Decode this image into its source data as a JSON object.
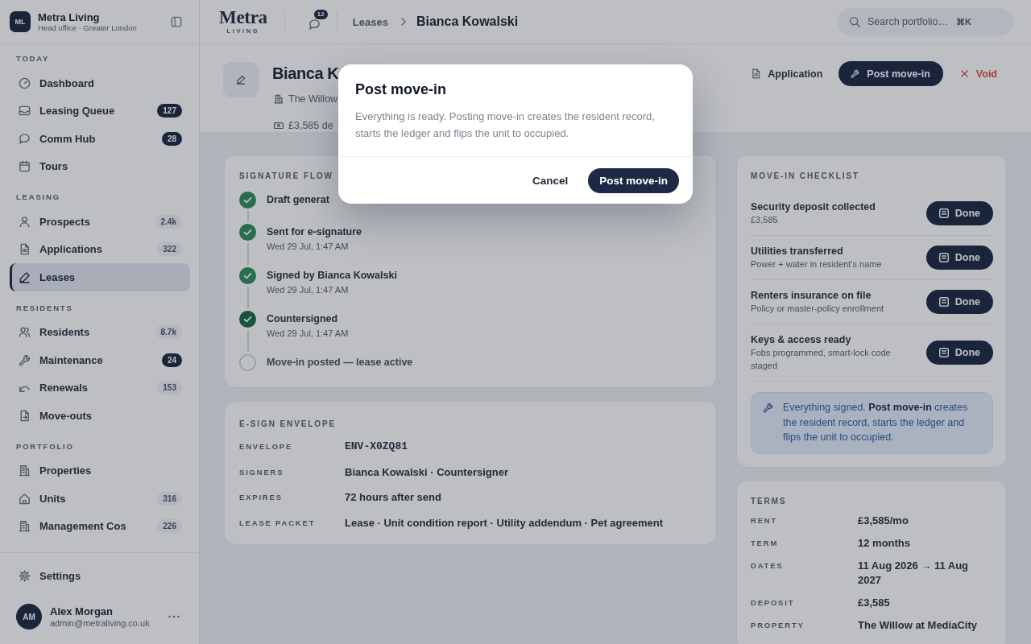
{
  "sidebar": {
    "brand": {
      "logo": "ML",
      "name": "Metra Living",
      "subtitle": "Head office · Greater London"
    },
    "sections": [
      {
        "label": "TODAY",
        "items": [
          {
            "label": "Dashboard",
            "selected": false
          },
          {
            "label": "Leasing Queue",
            "selected": false,
            "badge": {
              "text": "127",
              "urgent": true
            }
          },
          {
            "label": "Comm Hub",
            "selected": false,
            "badge": {
              "text": "28",
              "urgent": true
            }
          },
          {
            "label": "Tours",
            "selected": false
          }
        ]
      },
      {
        "label": "LEASING",
        "items": [
          {
            "label": "Prospects",
            "selected": false,
            "badge": {
              "text": "2.4k",
              "urgent": false
            }
          },
          {
            "label": "Applications",
            "selected": false,
            "badge": {
              "text": "322",
              "urgent": false
            }
          },
          {
            "label": "Leases",
            "selected": true
          }
        ]
      },
      {
        "label": "RESIDENTS",
        "items": [
          {
            "label": "Residents",
            "selected": false,
            "badge": {
              "text": "8.7k",
              "urgent": false
            }
          },
          {
            "label": "Maintenance",
            "selected": false,
            "badge": {
              "text": "24",
              "urgent": true
            }
          },
          {
            "label": "Renewals",
            "selected": false,
            "badge": {
              "text": "153",
              "urgent": false
            }
          },
          {
            "label": "Move-outs",
            "selected": false
          }
        ]
      },
      {
        "label": "PORTFOLIO",
        "items": [
          {
            "label": "Properties",
            "selected": false
          },
          {
            "label": "Units",
            "selected": false,
            "badge": {
              "text": "316",
              "urgent": false
            }
          },
          {
            "label": "Management Cos",
            "selected": false,
            "badge": {
              "text": "226",
              "urgent": false
            }
          }
        ]
      }
    ],
    "footer_items": [
      {
        "label": "Settings",
        "selected": false
      }
    ],
    "user": {
      "initials": "AM",
      "name": "Alex Morgan",
      "email": "admin@metraliving.co.uk"
    }
  },
  "topbar": {
    "logo": {
      "wordmark": "Metra",
      "tagline": "LIVING"
    },
    "notifications_badge": "12",
    "breadcrumbs": [
      "Leases",
      "Bianca Kowalski"
    ],
    "search": {
      "placeholder": "Search portfolio…",
      "shortcut": "⌘K"
    }
  },
  "page_header": {
    "title": "Bianca K",
    "meta": [
      "The Willow",
      "£3,585 de"
    ],
    "actions": [
      {
        "label": "Application",
        "kind": "link"
      },
      {
        "label": "Post move-in",
        "kind": "primary"
      },
      {
        "label": "Void",
        "kind": "danger"
      }
    ]
  },
  "signature_flow": {
    "title": "SIGNATURE FLOW",
    "steps": [
      {
        "label": "Draft generat",
        "done": true,
        "current": false
      },
      {
        "label": "Sent for e-signature",
        "time": "Wed 29 Jul, 1:47 AM",
        "done": true,
        "current": false
      },
      {
        "label": "Signed by Bianca Kowalski",
        "time": "Wed 29 Jul, 1:47 AM",
        "done": true,
        "current": false
      },
      {
        "label": "Countersigned",
        "time": "Wed 29 Jul, 1:47 AM",
        "done": true,
        "current": true
      },
      {
        "label": "Move-in posted — lease active",
        "done": false,
        "current": false
      }
    ]
  },
  "envelope": {
    "title": "E-SIGN ENVELOPE",
    "rows": [
      {
        "label": "ENVELOPE",
        "value": "ENV-X0ZQ81",
        "kind": "mono"
      },
      {
        "label": "SIGNERS",
        "value": "Bianca Kowalski · Countersigner",
        "kind": "text"
      },
      {
        "label": "EXPIRES",
        "value": "72 hours after send",
        "kind": "text"
      },
      {
        "label": "LEASE PACKET",
        "value": "Lease · Unit condition report · Utility addendum · Pet agreement",
        "kind": "text"
      }
    ]
  },
  "checklist": {
    "title": "MOVE-IN CHECKLIST",
    "items": [
      {
        "title": "Security deposit collected",
        "detail": "£3,585",
        "action": "Done"
      },
      {
        "title": "Utilities transferred",
        "detail": "Power + water in resident's name",
        "action": "Done"
      },
      {
        "title": "Renters insurance on file",
        "detail": "Policy or master-policy enrollment",
        "action": "Done"
      },
      {
        "title": "Keys & access ready",
        "detail": "Fobs programmed, smart-lock code staged",
        "action": "Done"
      }
    ],
    "note": "Everything signed. **Post move-in** creates the resident record, starts the ledger and flips the unit to occupied."
  },
  "terms": {
    "title": "TERMS",
    "rows": [
      {
        "label": "RENT",
        "value": "£3,585/mo"
      },
      {
        "label": "TERM",
        "value": "12 months"
      },
      {
        "label": "DATES",
        "value": "11 Aug 2026 → 11 Aug 2027"
      },
      {
        "label": "DEPOSIT",
        "value": "£3,585"
      },
      {
        "label": "PROPERTY",
        "value": "The Willow at MediaCity"
      }
    ]
  },
  "modal": {
    "title": "Post move-in",
    "body": "Everything is ready. Posting move-in creates the resident record, starts the ledger and flips the unit to occupied.",
    "buttons": [
      {
        "label": "Cancel",
        "kind": "secondary"
      },
      {
        "label": "Post move-in",
        "kind": "primary"
      }
    ]
  }
}
